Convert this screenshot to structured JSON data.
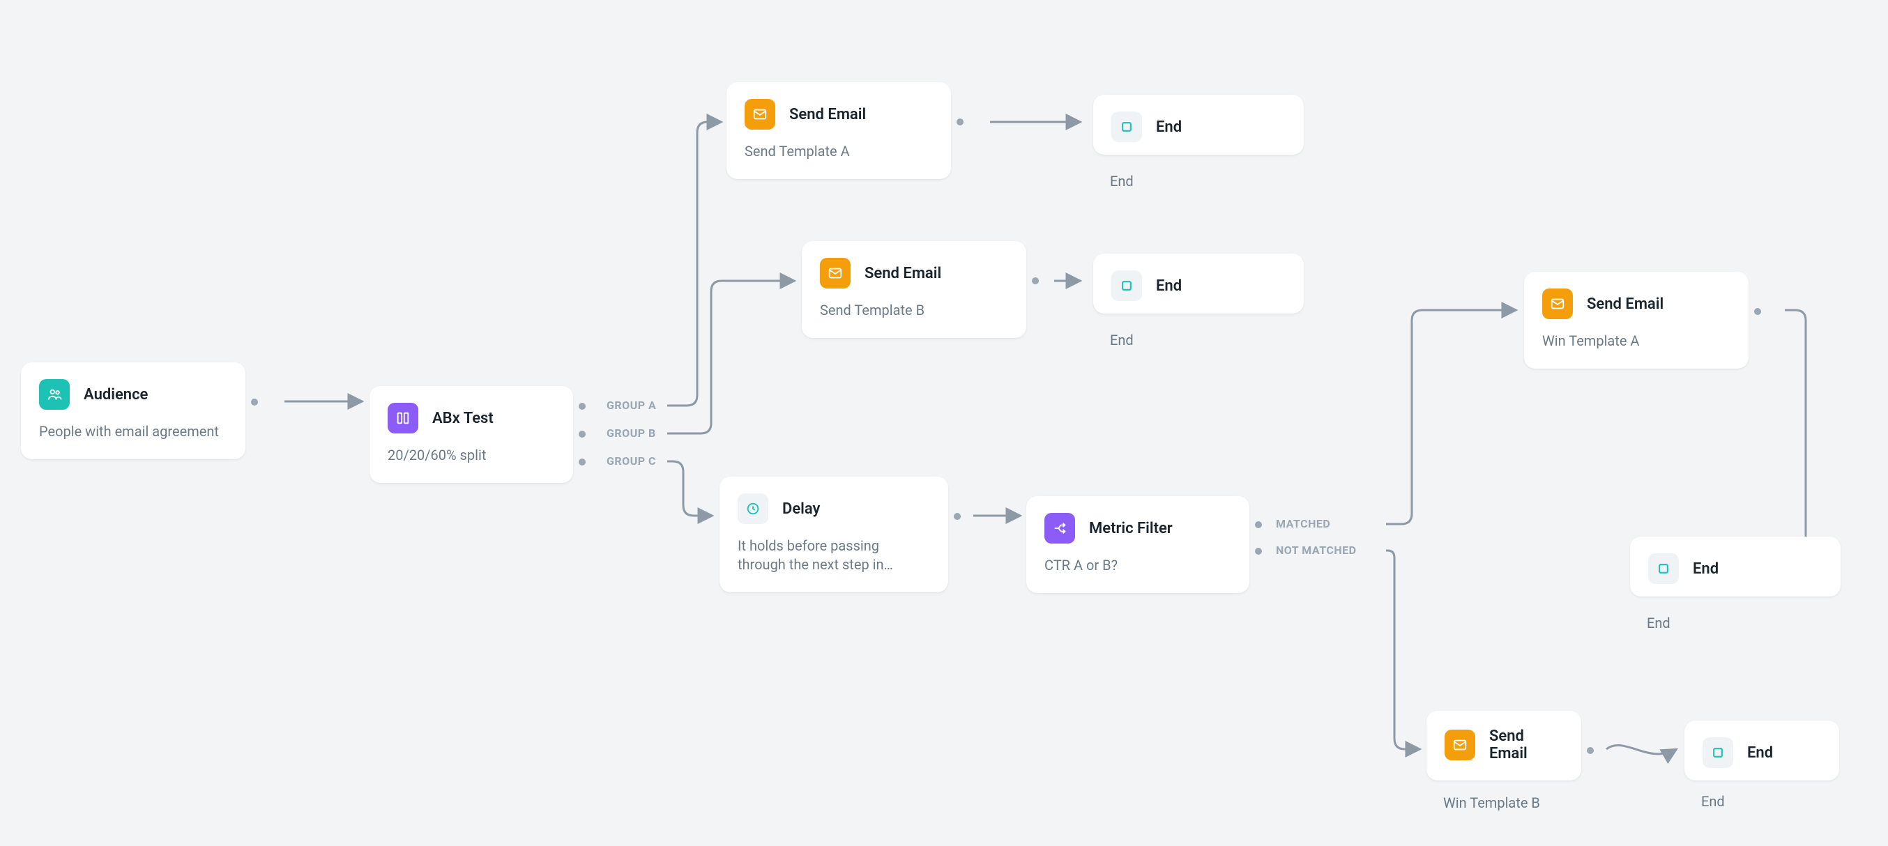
{
  "nodes": {
    "audience": {
      "title": "Audience",
      "desc": "People with email agreement"
    },
    "abx": {
      "title": "ABx Test",
      "desc": "20/20/60% split",
      "ports": [
        "GROUP A",
        "GROUP B",
        "GROUP C"
      ]
    },
    "emailA": {
      "title": "Send Email",
      "desc": "Send Template A"
    },
    "emailB": {
      "title": "Send Email",
      "desc": "Send Template B"
    },
    "delay": {
      "title": "Delay",
      "desc": "It holds before passing through the next step in…"
    },
    "metric": {
      "title": "Metric Filter",
      "desc": "CTR A or B?",
      "ports": [
        "MATCHED",
        "NOT MATCHED"
      ]
    },
    "winA": {
      "title": "Send Email",
      "desc": "Win Template A"
    },
    "winB": {
      "title": "Send Email",
      "desc": "Win Template B"
    },
    "end1": {
      "title": "End",
      "desc": "End"
    },
    "end2": {
      "title": "End",
      "desc": "End"
    },
    "end3": {
      "title": "End",
      "desc": "End"
    },
    "end4": {
      "title": "End",
      "desc": "End"
    }
  },
  "colors": {
    "teal": "#1DC2B4",
    "purple": "#8B5CF6",
    "orange": "#F59E0B",
    "gray_bg": "#F0F3F5",
    "text": "#19242d",
    "muted": "#6b7a86",
    "connector": "#8d99a4"
  }
}
